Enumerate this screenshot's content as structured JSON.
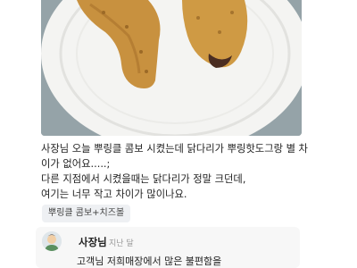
{
  "review": {
    "lines": [
      "사장님 오늘 뿌링클 콤보 시켰는데 닭다리가 뿌링핫도그랑 별 차",
      "이가 없어요.....;",
      "다른 지점에서 시켰을때는 닭다리가 정말 크던데,",
      "여기는 너무 작고 차이가 많이나요."
    ],
    "menu_tag": "뿌링클 콤보+치즈볼"
  },
  "reply": {
    "author": "사장님",
    "time": "지난 달",
    "body": "고객님 저희매장에서 많은 불편함을"
  },
  "colors": {
    "plate": "#f4f4f2",
    "chicken": "#c8913f",
    "tag_bg": "#eef0f3",
    "reply_bg": "#f7f7f7"
  }
}
